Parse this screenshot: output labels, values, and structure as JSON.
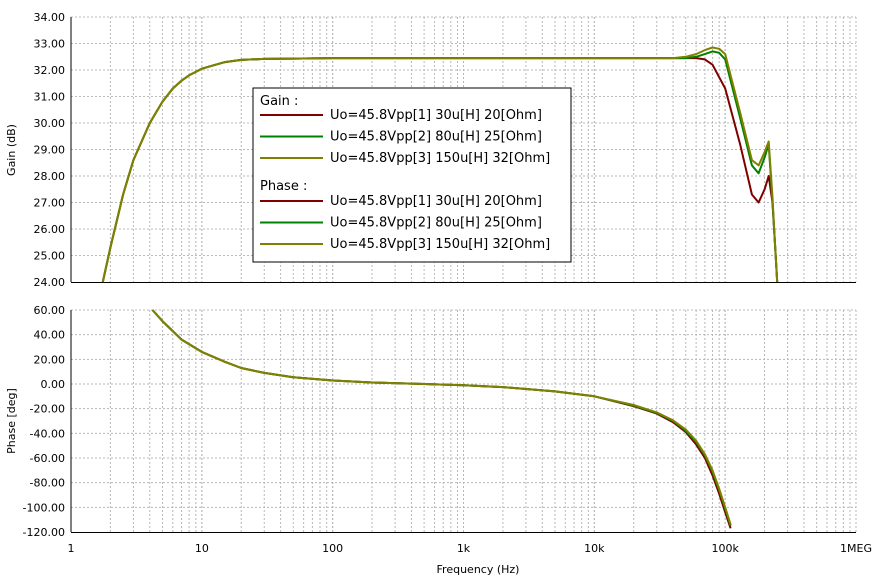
{
  "chart_data": [
    {
      "type": "line",
      "ylabel": "Gain (dB)",
      "xscale": "log",
      "xlim": [
        1,
        1000000
      ],
      "ylim": [
        24,
        34
      ],
      "y_ticks": [
        "34.00",
        "33.00",
        "32.00",
        "31.00",
        "30.00",
        "29.00",
        "28.00",
        "27.00",
        "26.00",
        "25.00",
        "24.00"
      ],
      "grid": true,
      "legend": {
        "placement": "center-left",
        "groups": [
          {
            "header": "Gain :",
            "entries": [
              "Uo=45.8Vpp[1]  30u[H] 20[Ohm]",
              "Uo=45.8Vpp[2]  80u[H] 25[Ohm]",
              "Uo=45.8Vpp[3]  150u[H] 32[Ohm]"
            ]
          },
          {
            "header": "Phase :",
            "entries": [
              "Uo=45.8Vpp[1]  30u[H] 20[Ohm]",
              "Uo=45.8Vpp[2]  80u[H] 25[Ohm]",
              "Uo=45.8Vpp[3]  150u[H] 32[Ohm]"
            ]
          }
        ]
      },
      "series": [
        {
          "name": "Uo=45.8Vpp[1]  30u[H] 20[Ohm]",
          "color": "#800000",
          "x": [
            1.75,
            2,
            2.5,
            3,
            4,
            5,
            6,
            7,
            8,
            10,
            15,
            20,
            30,
            50,
            100,
            1000,
            10000,
            40000,
            50000,
            60000,
            70000,
            80000,
            100000,
            130000,
            160000,
            180000,
            200000,
            215000,
            230000,
            240000,
            250000
          ],
          "y": [
            24.0,
            25.3,
            27.3,
            28.6,
            30.0,
            30.8,
            31.3,
            31.6,
            31.8,
            32.05,
            32.3,
            32.38,
            32.42,
            32.43,
            32.45,
            32.45,
            32.45,
            32.45,
            32.45,
            32.45,
            32.4,
            32.2,
            31.3,
            29.2,
            27.3,
            27.0,
            27.5,
            28.0,
            27.0,
            25.5,
            24.0
          ]
        },
        {
          "name": "Uo=45.8Vpp[2]  80u[H] 25[Ohm]",
          "color": "#008000",
          "x": [
            1.75,
            2,
            2.5,
            3,
            4,
            5,
            6,
            7,
            8,
            10,
            15,
            20,
            30,
            50,
            100,
            1000,
            10000,
            40000,
            50000,
            60000,
            70000,
            80000,
            90000,
            100000,
            130000,
            160000,
            180000,
            200000,
            215000,
            230000,
            240000,
            250000
          ],
          "y": [
            24.0,
            25.3,
            27.3,
            28.6,
            30.0,
            30.8,
            31.3,
            31.6,
            31.8,
            32.05,
            32.3,
            32.38,
            32.42,
            32.43,
            32.45,
            32.45,
            32.45,
            32.45,
            32.45,
            32.5,
            32.6,
            32.7,
            32.65,
            32.4,
            30.2,
            28.4,
            28.1,
            28.7,
            29.2,
            27.0,
            25.5,
            24.0
          ]
        },
        {
          "name": "Uo=45.8Vpp[3]  150u[H] 32[Ohm]",
          "color": "#808000",
          "x": [
            1.75,
            2,
            2.5,
            3,
            4,
            5,
            6,
            7,
            8,
            10,
            15,
            20,
            30,
            50,
            100,
            1000,
            10000,
            40000,
            50000,
            60000,
            70000,
            80000,
            90000,
            100000,
            130000,
            160000,
            180000,
            200000,
            215000,
            230000,
            240000,
            250000
          ],
          "y": [
            24.0,
            25.3,
            27.3,
            28.6,
            30.0,
            30.8,
            31.3,
            31.6,
            31.8,
            32.05,
            32.3,
            32.38,
            32.42,
            32.43,
            32.45,
            32.45,
            32.45,
            32.45,
            32.5,
            32.6,
            32.75,
            32.85,
            32.8,
            32.6,
            30.4,
            28.6,
            28.4,
            28.9,
            29.3,
            27.2,
            25.5,
            24.0
          ]
        }
      ]
    },
    {
      "type": "line",
      "xlabel": "Frequency (Hz)",
      "ylabel": "Phase [deg]",
      "xscale": "log",
      "xlim": [
        1,
        1000000
      ],
      "ylim": [
        -120,
        60
      ],
      "x_ticks": [
        "1",
        "10",
        "100",
        "1k",
        "10k",
        "100k",
        "1MEG"
      ],
      "y_ticks": [
        "60.00",
        "40.00",
        "20.00",
        "0.00",
        "-20.00",
        "-40.00",
        "-60.00",
        "-80.00",
        "-100.00",
        "-120.00"
      ],
      "grid": true,
      "series": [
        {
          "name": "Uo=45.8Vpp[1]  30u[H] 20[Ohm]",
          "color": "#800000",
          "x": [
            4.2,
            5,
            7,
            10,
            15,
            20,
            30,
            50,
            100,
            200,
            500,
            1000,
            2000,
            5000,
            10000,
            20000,
            30000,
            40000,
            50000,
            60000,
            70000,
            80000,
            90000,
            100000,
            110000
          ],
          "y": [
            60,
            51,
            36,
            26,
            18,
            13,
            9,
            5.5,
            2.8,
            1.2,
            0,
            -1,
            -2.5,
            -6,
            -10,
            -18,
            -24,
            -31,
            -39,
            -49,
            -60,
            -74,
            -89,
            -104,
            -117
          ]
        },
        {
          "name": "Uo=45.8Vpp[2]  80u[H] 25[Ohm]",
          "color": "#008000",
          "x": [
            4.2,
            5,
            7,
            10,
            15,
            20,
            30,
            50,
            100,
            200,
            500,
            1000,
            2000,
            5000,
            10000,
            20000,
            30000,
            40000,
            50000,
            60000,
            70000,
            80000,
            90000,
            100000,
            110000
          ],
          "y": [
            60,
            51,
            36,
            26,
            18,
            13,
            9,
            5.5,
            2.8,
            1.2,
            0,
            -1,
            -2.5,
            -6,
            -10,
            -17.5,
            -23.5,
            -30,
            -38,
            -47,
            -58,
            -71,
            -86,
            -101,
            -115
          ]
        },
        {
          "name": "Uo=45.8Vpp[3]  150u[H] 32[Ohm]",
          "color": "#808000",
          "x": [
            4.2,
            5,
            7,
            10,
            15,
            20,
            30,
            50,
            100,
            200,
            500,
            1000,
            2000,
            5000,
            10000,
            20000,
            30000,
            40000,
            50000,
            60000,
            70000,
            80000,
            90000,
            100000,
            110000
          ],
          "y": [
            60,
            51,
            36,
            26,
            18,
            13,
            9,
            5.5,
            2.8,
            1.2,
            0,
            -1,
            -2.5,
            -6,
            -10,
            -17,
            -23,
            -29.5,
            -37,
            -46,
            -57,
            -70,
            -85,
            -100,
            -114
          ]
        }
      ]
    }
  ]
}
